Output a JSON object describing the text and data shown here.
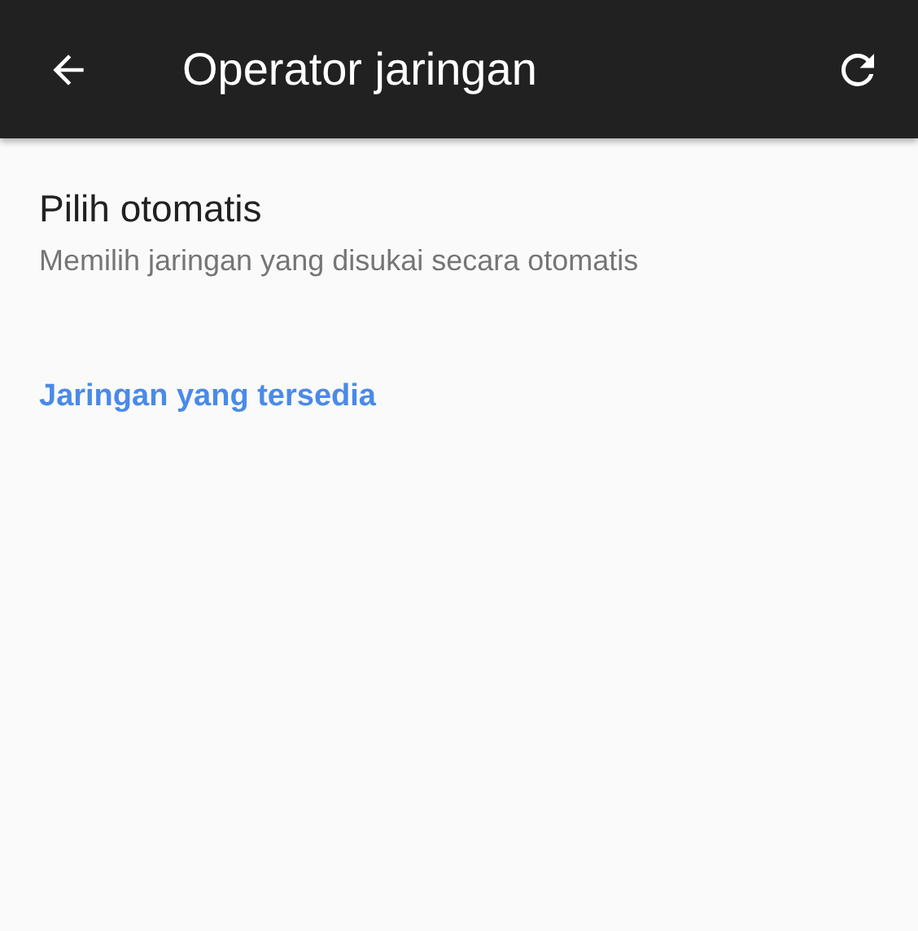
{
  "toolbar": {
    "title": "Operator jaringan"
  },
  "auto_select": {
    "title": "Pilih otomatis",
    "summary": "Memilih jaringan yang disukai secara otomatis"
  },
  "category": {
    "title": "Jaringan yang tersedia"
  }
}
